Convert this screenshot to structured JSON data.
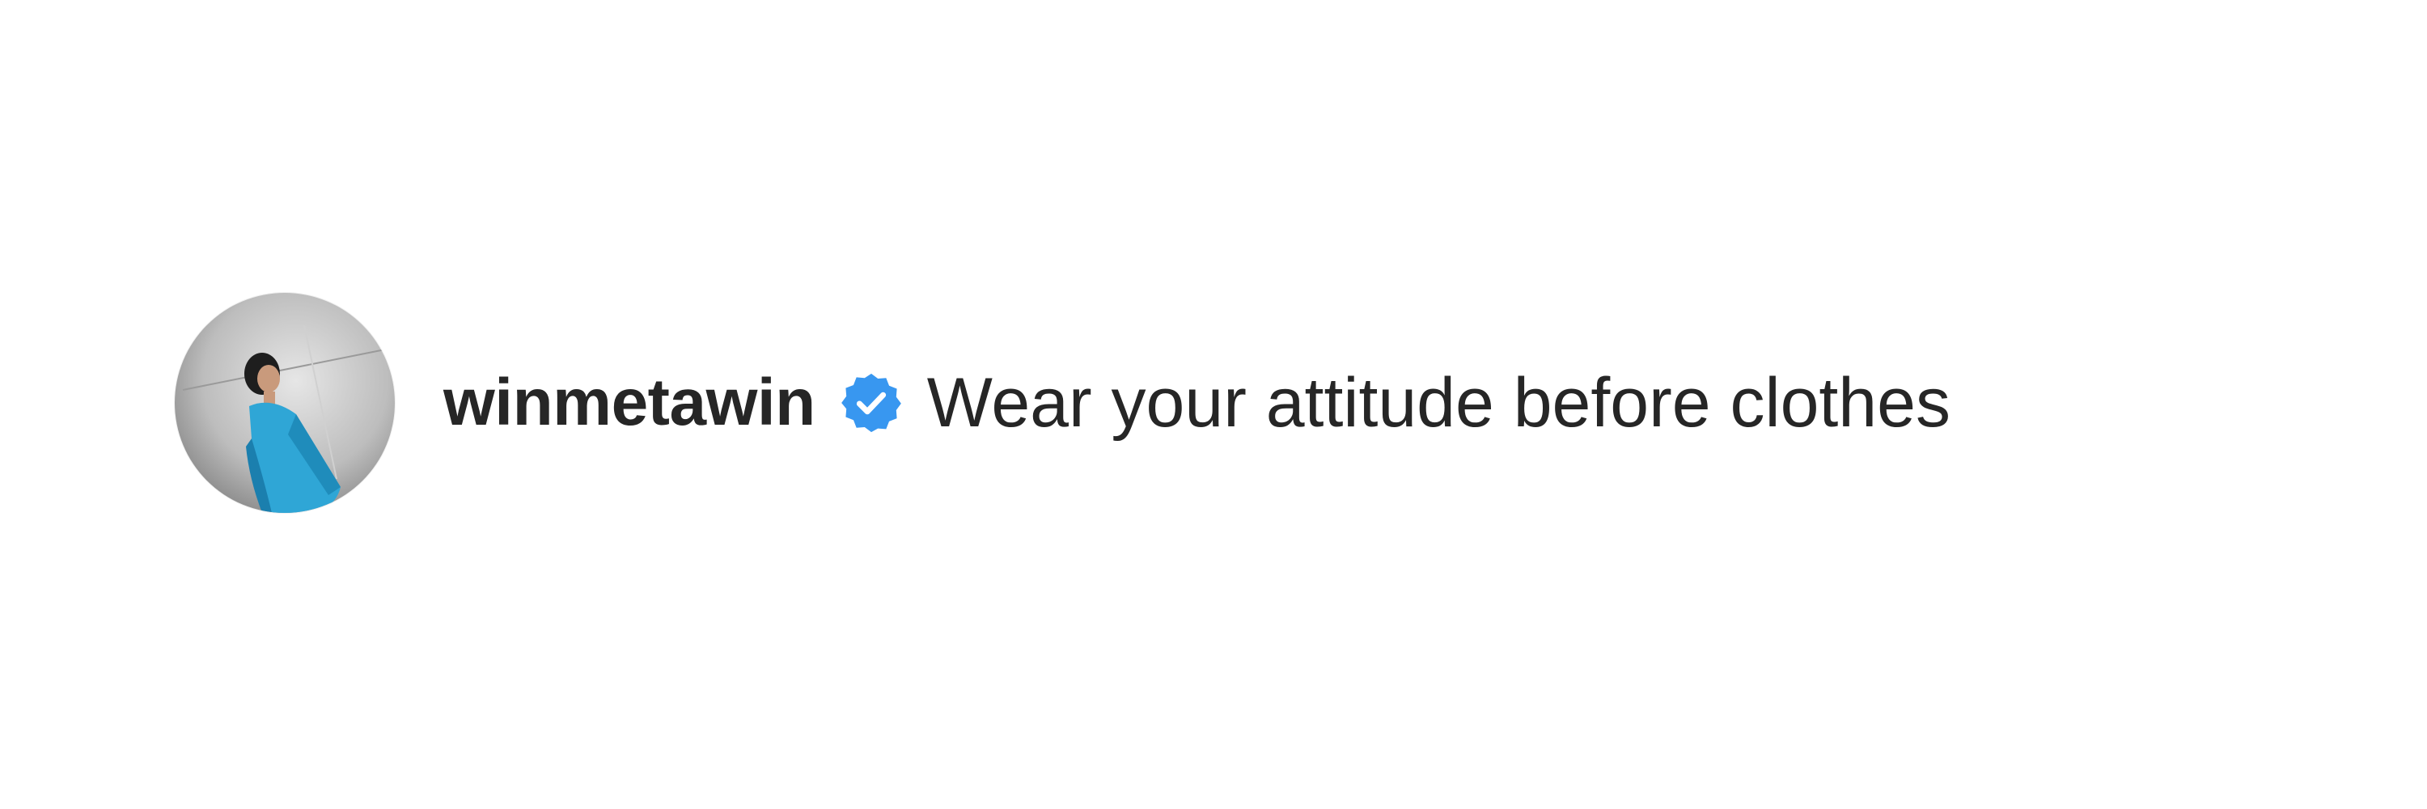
{
  "post": {
    "username": "winmetawin",
    "verified": true,
    "caption": "Wear your attitude before clothes"
  },
  "avatar": {
    "icon": "profile-photo"
  },
  "colors": {
    "text": "#262626",
    "verified_badge": "#3897f0",
    "background": "#ffffff"
  }
}
